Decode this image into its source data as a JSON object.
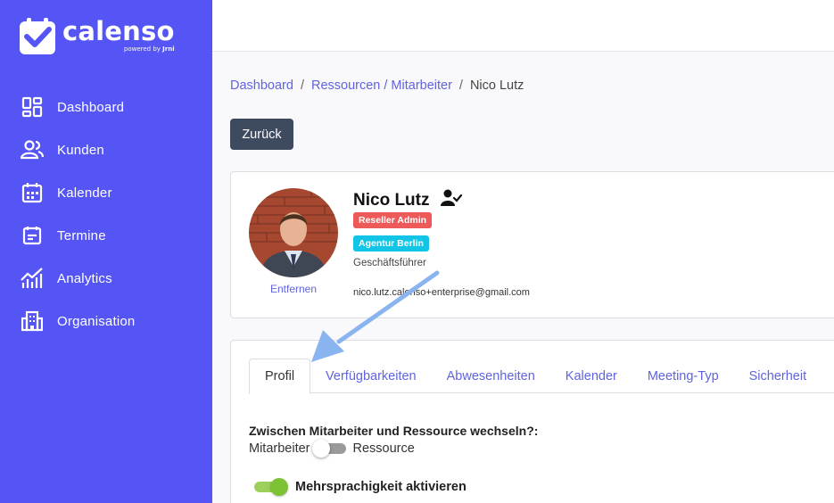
{
  "brand": {
    "name": "calenso",
    "powered_by": "powered by",
    "partner": "Jrni",
    "color": "#5555f6"
  },
  "sidebar": {
    "items": [
      {
        "label": "Dashboard",
        "icon": "dashboard-icon"
      },
      {
        "label": "Kunden",
        "icon": "customers-icon"
      },
      {
        "label": "Kalender",
        "icon": "calendar-icon"
      },
      {
        "label": "Termine",
        "icon": "appointments-icon"
      },
      {
        "label": "Analytics",
        "icon": "analytics-icon"
      },
      {
        "label": "Organisation",
        "icon": "organisation-icon"
      }
    ]
  },
  "breadcrumb": {
    "items": [
      "Dashboard",
      "Ressourcen / Mitarbeiter"
    ],
    "separator": "/",
    "current": "Nico Lutz"
  },
  "back_button": {
    "label": "Zurück"
  },
  "profile": {
    "name": "Nico Lutz",
    "name_icon": "user-check-icon",
    "badges": [
      {
        "label": "Reseller Admin",
        "color": "#ee5a5a"
      },
      {
        "label": "Agentur Berlin",
        "color": "#12c5e6"
      }
    ],
    "role": "Geschäftsführer",
    "email": "nico.lutz.calenso+enterprise@gmail.com",
    "remove_label": "Entfernen"
  },
  "tabs": {
    "items": [
      "Profil",
      "Verfügbarkeiten",
      "Abwesenheiten",
      "Kalender",
      "Meeting-Typ",
      "Sicherheit"
    ],
    "active": "Profil"
  },
  "profile_tab": {
    "switch_question": "Zwischen Mitarbeiter und Ressource wechseln?:",
    "switch_left_label": "Mitarbeiter",
    "switch_right_label": "Ressource",
    "switch_on": false,
    "multilang_label": "Mehrsprachigkeit aktivieren",
    "multilang_on": true
  },
  "colors": {
    "link": "#6063e0",
    "annotation_arrow": "#8ab4f0"
  }
}
